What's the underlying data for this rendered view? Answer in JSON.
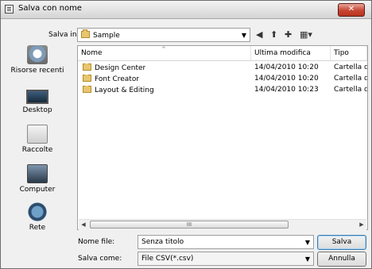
{
  "window": {
    "title": "Salva con nome",
    "close_label": "✕"
  },
  "location": {
    "label": "Salva in:",
    "value": "Sample"
  },
  "places": [
    {
      "label": "Risorse recenti",
      "icon": "recent-places-icon"
    },
    {
      "label": "Desktop",
      "icon": "desktop-icon"
    },
    {
      "label": "Raccolte",
      "icon": "libraries-icon"
    },
    {
      "label": "Computer",
      "icon": "computer-icon"
    },
    {
      "label": "Rete",
      "icon": "network-icon"
    }
  ],
  "columns": {
    "name": "Nome",
    "modified": "Ultima modifica",
    "type": "Tipo"
  },
  "files": [
    {
      "name": "Design Center",
      "modified": "14/04/2010 10:20",
      "type": "Cartella di"
    },
    {
      "name": "Font Creator",
      "modified": "14/04/2010 10:20",
      "type": "Cartella di"
    },
    {
      "name": "Layout & Editing",
      "modified": "14/04/2010 10:23",
      "type": "Cartella di"
    }
  ],
  "scrollbar": {
    "thumb_grip": "III"
  },
  "filename": {
    "label": "Nome file:",
    "value": "Senza titolo"
  },
  "filetype": {
    "label": "Salva come:",
    "value": "File CSV(*.csv)"
  },
  "buttons": {
    "save": "Salva",
    "cancel": "Annulla"
  }
}
